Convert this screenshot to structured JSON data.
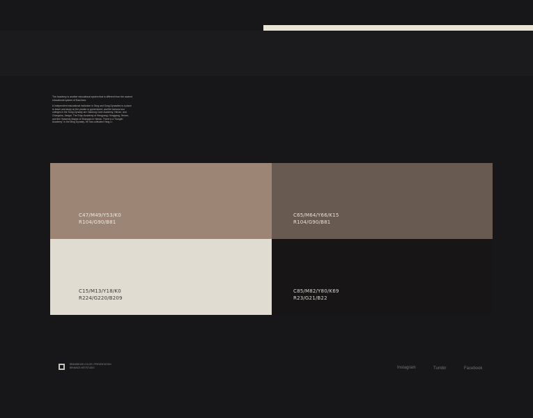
{
  "intro": {
    "paragraph1": "The Academy is another educational system that is different from the ancient educational system of East Asia.",
    "paragraph2": "A independent educational institution in Tang and Song Dynasties is a place to teach and study on the private or government, and the famous four colleges in the Song Dynasty are Xiaolong Cave Academy, Henan, and Changsha, Jiangxi. The Ertyu Academy of Hengyang, Hongyang, Henan, and the Heavenly Mapse of Shangqiu in Henan. There is a \"Songlin Academy\" in the Ming Dynasty. He has cultivated Yang Li."
  },
  "palette": [
    {
      "cmyk": "C47/M49/Y53/K0",
      "rgb": "R104/G90/B81",
      "fill": "#9c8575",
      "text_color": "#efe9e2"
    },
    {
      "cmyk": "C65/M64/Y66/K15",
      "rgb": "R104/G90/B81",
      "fill": "#695a51",
      "text_color": "#e6e0d8"
    },
    {
      "cmyk": "C15/M13/Y18/K0",
      "rgb": "R224/G220/B209",
      "fill": "#e0dcd1",
      "text_color": "#3a3734"
    },
    {
      "cmyk": "C85/M82/Y80/K69",
      "rgb": "R23/G21/B22",
      "fill": "#171516",
      "text_color": "#dcd8d2"
    }
  ],
  "footer": {
    "logo_icon": "square-logo",
    "line1": "BRANDBOOK.COLOR / PRESENTATION",
    "line2": "BEHANCE.NET/STUDIO",
    "links": [
      "Instagram",
      "Tumblr",
      "Facebook"
    ]
  },
  "colors": {
    "background": "#171618",
    "band": "#1b1b1d",
    "accent_rule": "#e8e4d6"
  }
}
